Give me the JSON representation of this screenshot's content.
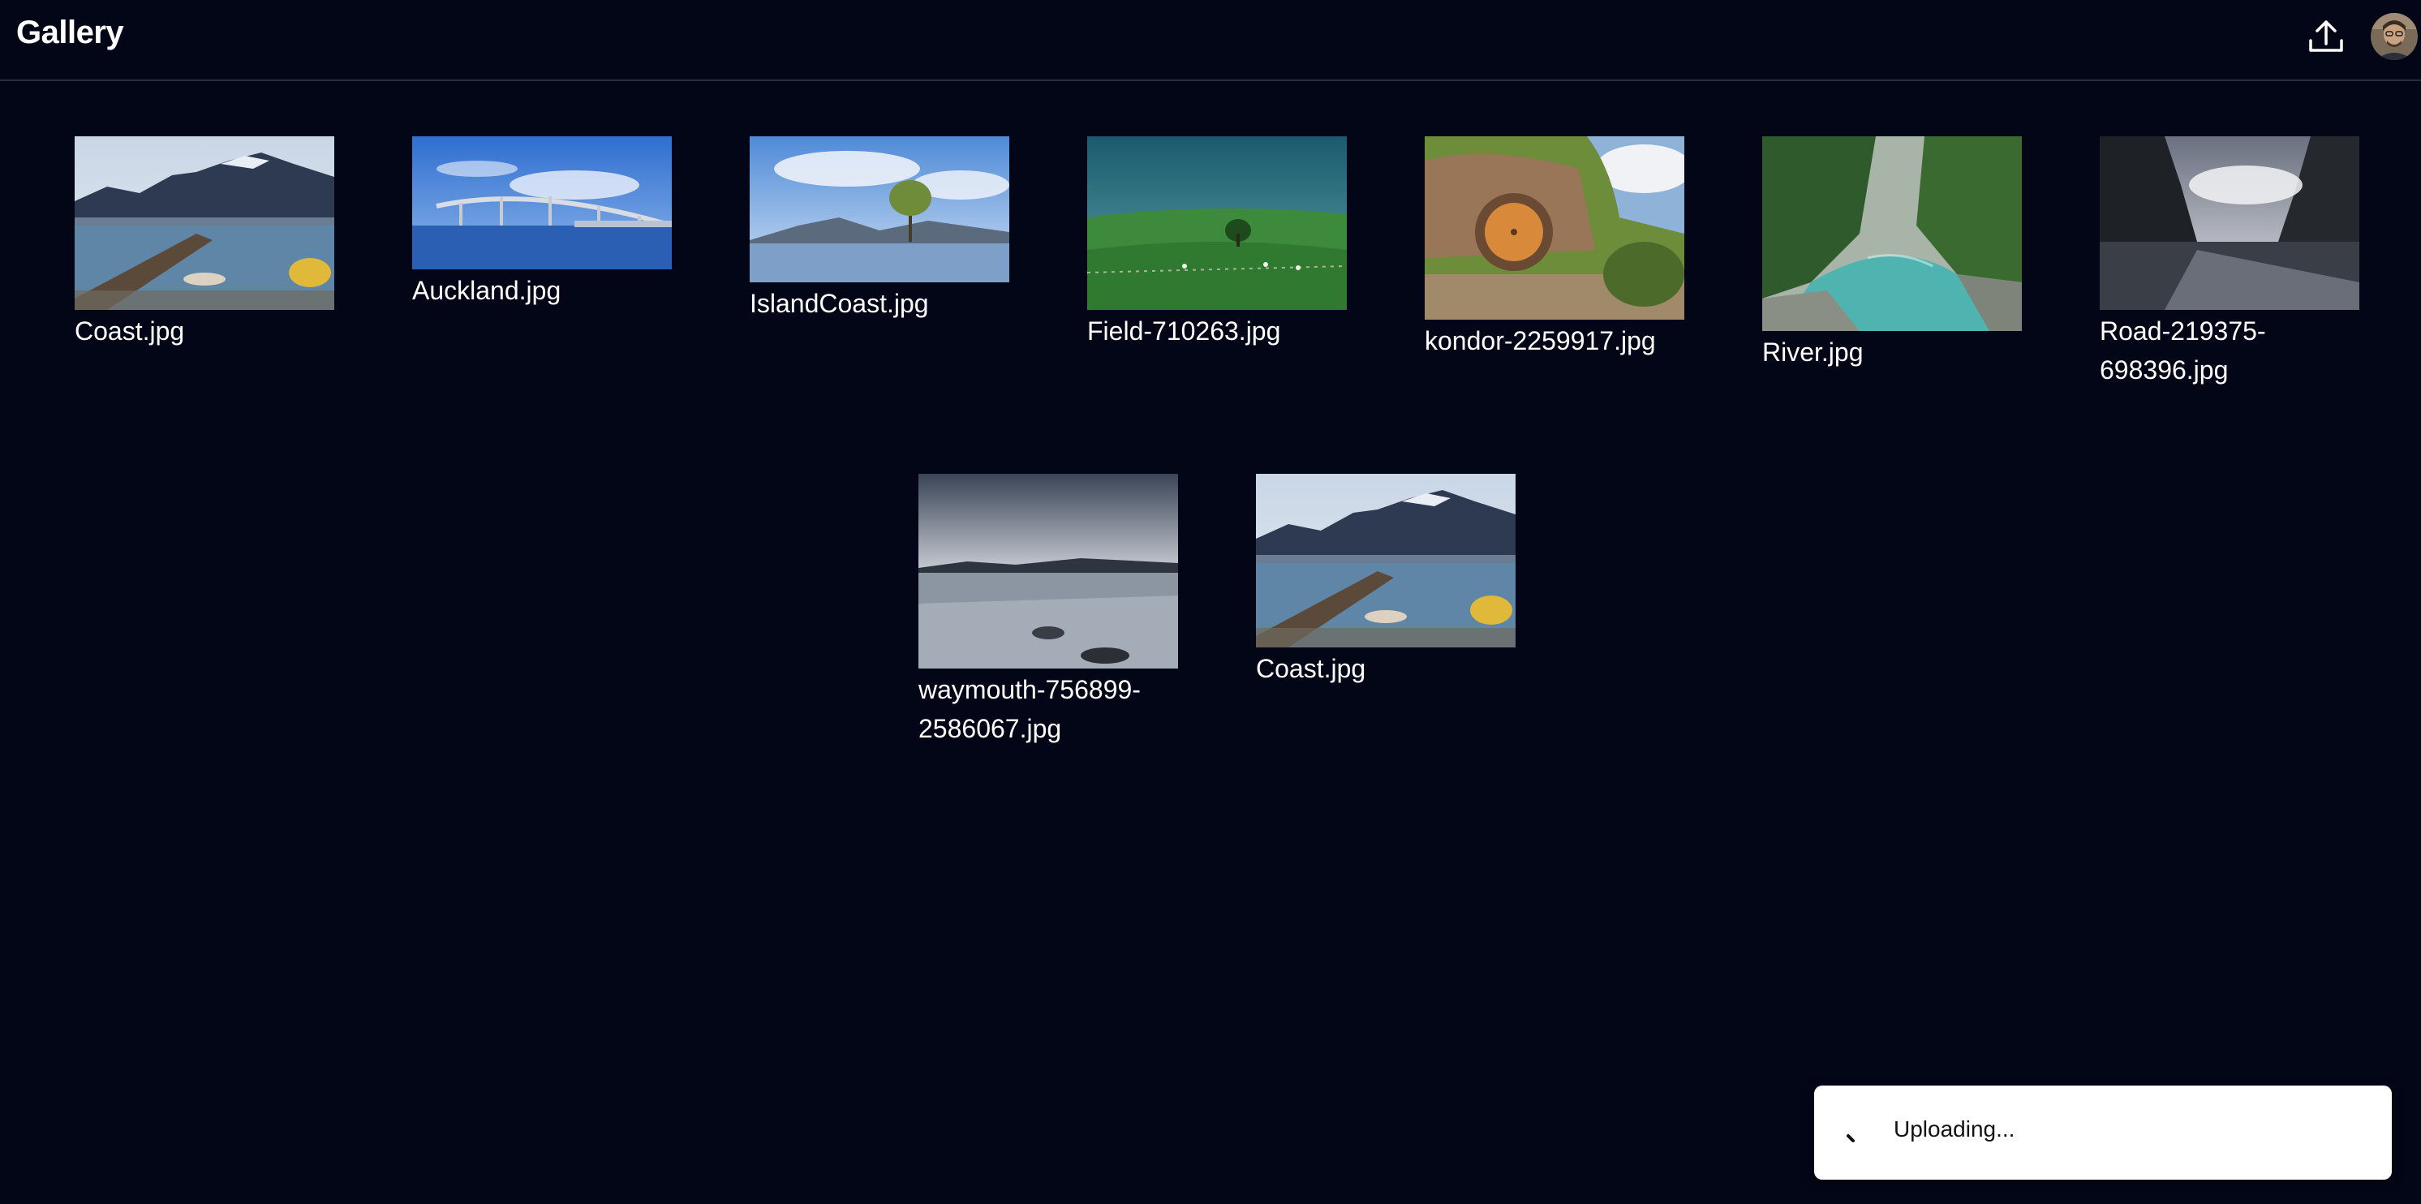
{
  "header": {
    "title": "Gallery",
    "upload_icon": "upload-icon",
    "avatar_icon": "user-avatar"
  },
  "gallery": {
    "items": [
      {
        "filename": "Coast.jpg",
        "scene": "harbor-pier-mountains"
      },
      {
        "filename": "Auckland.jpg",
        "scene": "harbor-bridge-blue-sky"
      },
      {
        "filename": "IslandCoast.jpg",
        "scene": "lone-tree-in-lake"
      },
      {
        "filename": "Field-710263.jpg",
        "scene": "green-field-sheep"
      },
      {
        "filename": "kondor-2259917.jpg",
        "scene": "hobbit-hole-round-door"
      },
      {
        "filename": "River.jpg",
        "scene": "turquoise-river-forest"
      },
      {
        "filename": "Road-219375-698396.jpg",
        "scene": "fiord-clouds"
      },
      {
        "filename": "waymouth-756899-2586067.jpg",
        "scene": "calm-lake-rocks"
      },
      {
        "filename": "Coast.jpg",
        "scene": "harbor-pier-mountains"
      }
    ]
  },
  "toast": {
    "text": "Uploading...",
    "icon": "spinner-icon"
  },
  "colors": {
    "background": "#030617",
    "divider": "#2a2f3f",
    "toast_background": "#ffffff"
  }
}
